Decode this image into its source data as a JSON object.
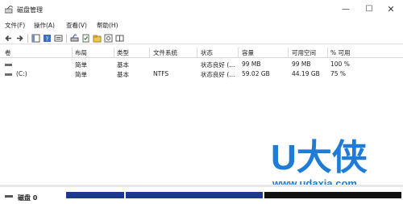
{
  "window": {
    "title": "磁盘管理",
    "controls": {
      "minimize": "—",
      "maximize": "☐",
      "close": "✕"
    }
  },
  "menu": {
    "file": "文件(F)",
    "action": "操作(A)",
    "view": "查看(V)",
    "help": "帮助(H)"
  },
  "toolbar": {
    "icons": [
      "back-arrow-icon",
      "forward-arrow-icon",
      "console-tree-icon",
      "help-icon",
      "disk-list-icon",
      "properties-icon",
      "checkmark-doc-icon",
      "folder-icon",
      "settings-icon",
      "layout-icon"
    ]
  },
  "table": {
    "headers": [
      "卷",
      "布局",
      "类型",
      "文件系统",
      "状态",
      "容量",
      "可用空间",
      "% 可用"
    ],
    "rows": [
      {
        "volume": "",
        "layout": "简单",
        "type": "基本",
        "fs": "",
        "status": "状态良好 (...",
        "capacity": "99 MB",
        "free": "99 MB",
        "pct": "100 %"
      },
      {
        "volume": "(C:)",
        "layout": "简单",
        "type": "基本",
        "fs": "NTFS",
        "status": "状态良好 (...",
        "capacity": "59.02 GB",
        "free": "44.19 GB",
        "pct": "75 %"
      }
    ]
  },
  "disk": {
    "label": "磁盘 0"
  },
  "watermark": {
    "brand": "U大侠",
    "url": "www.udaxia.com"
  },
  "colors": {
    "partition_blue": "#1c3a8c",
    "partition_black": "#111111",
    "watermark_blue": "#1f7bd4"
  }
}
